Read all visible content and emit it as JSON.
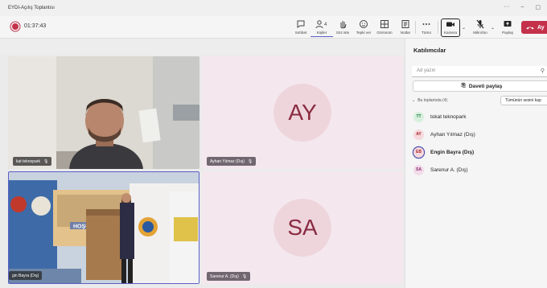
{
  "window": {
    "title": "EYDI-Açılış Toplantısı",
    "controls": [
      "···",
      "–",
      "▢"
    ]
  },
  "toolbar": {
    "timer": "01:37:43",
    "items": [
      {
        "label": "Sohbet",
        "icon": "chat-icon"
      },
      {
        "label": "Kişiler",
        "icon": "people-icon",
        "badge": "4"
      },
      {
        "label": "Söz iste",
        "icon": "raise-hand-icon"
      },
      {
        "label": "Tepki ver",
        "icon": "react-icon"
      },
      {
        "label": "Görünüm",
        "icon": "view-icon"
      },
      {
        "label": "Notlar",
        "icon": "notes-icon"
      },
      {
        "label": "Tümü",
        "icon": "more-icon"
      },
      {
        "label": "Kamera",
        "icon": "camera-icon"
      },
      {
        "label": "Mikrofon",
        "icon": "mic-muted-icon"
      },
      {
        "label": "Paylaş",
        "icon": "share-icon"
      }
    ],
    "leave_label": "Ay"
  },
  "colors": {
    "accent": "#5b5fc7",
    "leave": "#c4314b",
    "avatar_bg": "#eed5dc",
    "avatar_text": "#8a2b41"
  },
  "tiles": [
    {
      "name": "kat teknopark"
    },
    {
      "name": "Ayhan Yılmaz (Dış)",
      "initials": "AY"
    },
    {
      "name": "gin Bayra (Dış)"
    },
    {
      "name": "Sarenur A. (Dış)",
      "initials": "SA"
    }
  ],
  "stage_photo_text": {
    "banner": "HOŞGE"
  },
  "panel": {
    "title": "Katılımcılar",
    "search_placeholder": "Ad yazın",
    "share_label": "Daveti paylaş",
    "section_label": "Bu toplantıda (4)",
    "mute_all_label": "Tümünün sesini kap",
    "participants": [
      {
        "initials": "TT",
        "name": "tokat teknopark",
        "bg": "#d7f0dd",
        "fg": "#237b4b"
      },
      {
        "initials": "AY",
        "name": "Ayhan Yılmaz (Dış)",
        "bg": "#f6d9dd",
        "fg": "#a4262c"
      },
      {
        "initials": "EB",
        "name": "Engin Bayra (Dış)",
        "bg": "#f6d9dd",
        "fg": "#a4262c"
      },
      {
        "initials": "SA",
        "name": "Sarenur A. (Dış)",
        "bg": "#f1dbe9",
        "fg": "#8a2b6b"
      }
    ]
  }
}
